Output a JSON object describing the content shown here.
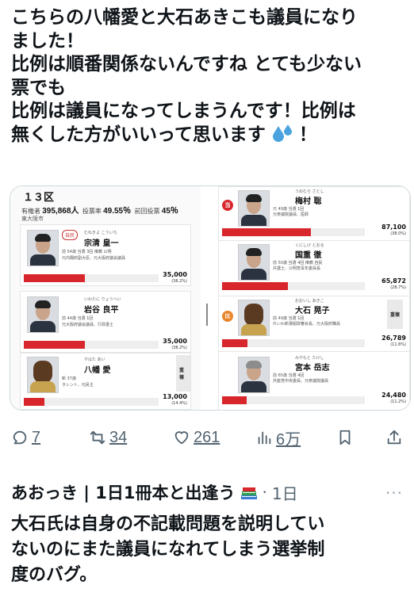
{
  "tweet": {
    "lines": [
      "こちらの八幡愛と大石あきこも議員になり",
      "ました！",
      "比例は順番関係ないんですね とても少ない",
      "票でも",
      "比例は議員になってしまうんです！比例は",
      "無くした方がいいって思います"
    ],
    "tail": "！",
    "emoji_icon": "sweat-droplets-icon"
  },
  "image": {
    "district": "１３区",
    "stats_left_label": "有権者",
    "stats_left_value": "395,868人",
    "stats_mid_label": "投票率",
    "stats_mid_value": "49.55％",
    "stats_right_label": "前回投票",
    "stats_right_value": "45％",
    "area": "東大阪市",
    "left": [
      {
        "kana": "むねきよ こういち",
        "name": "宗清 皇一",
        "details": "前 54歳 当選 3回 推薦 公明",
        "details2": "元内閣府副大臣、元大阪府議会議員",
        "votes": "35,000",
        "pct": "(38.2%)",
        "share": 0.45
      },
      {
        "kana": "いわたに りょうへい",
        "name": "岩谷 良平",
        "details": "前 44歳 当選 1回",
        "details2": "元大阪府議会議員、行政書士",
        "votes": "35,000",
        "pct": "(38.2%)",
        "share": 0.45
      },
      {
        "kana": "やはた あい",
        "name": "八幡 愛",
        "details": "新 37歳",
        "details2": "タレント、元民主",
        "votes": "13,000",
        "pct": "(14.4%)",
        "share": 0.15,
        "badge": "重複"
      }
    ],
    "right": [
      {
        "kana": "うめむら さとし",
        "name": "梅村 聡",
        "details": "元 49歳 当選 1回",
        "details2": "元参議院議員、医師",
        "votes": "87,100",
        "pct": "(38.0%)",
        "share": 0.62
      },
      {
        "kana": "くにしげ とおる",
        "name": "国重 徹",
        "details": "前 50歳 当選 4回 推薦 自民",
        "details2": "弁護士、公明党青年委員長",
        "votes": "65,872",
        "pct": "(28.7%)",
        "share": 0.46
      },
      {
        "kana": "おおいし あきこ",
        "name": "大石 晃子",
        "details": "前 49歳 当選 1回",
        "details2": "れいわ新選組政審会長、元大阪府職員",
        "votes": "26,789",
        "pct": "(11.6%)",
        "share": 0.18,
        "badge": "重複"
      },
      {
        "kana": "みやもと たけし",
        "name": "宮本 岳志",
        "details": "前 65歳 当選 4回",
        "details2": "共産党中央委員、元参議院議員",
        "votes": "24,480",
        "pct": "(11.2%)",
        "share": 0.17
      }
    ]
  },
  "actions": {
    "reply_count": "7",
    "retweet_count": "34",
    "like_count": "261",
    "view_count": "6万"
  },
  "reply": {
    "author": "あおっき | 1日1冊本と出逢う",
    "separator": "·",
    "time": "1日",
    "more": "···",
    "lines": [
      "大石氏は自身の不記載問題を説明してい",
      "ないのにまた議員になれてしまう選挙制",
      "度のバグ。"
    ]
  },
  "colors": {
    "bar_red": "#d8262d",
    "muted": "#536471",
    "text": "#0f1419"
  }
}
